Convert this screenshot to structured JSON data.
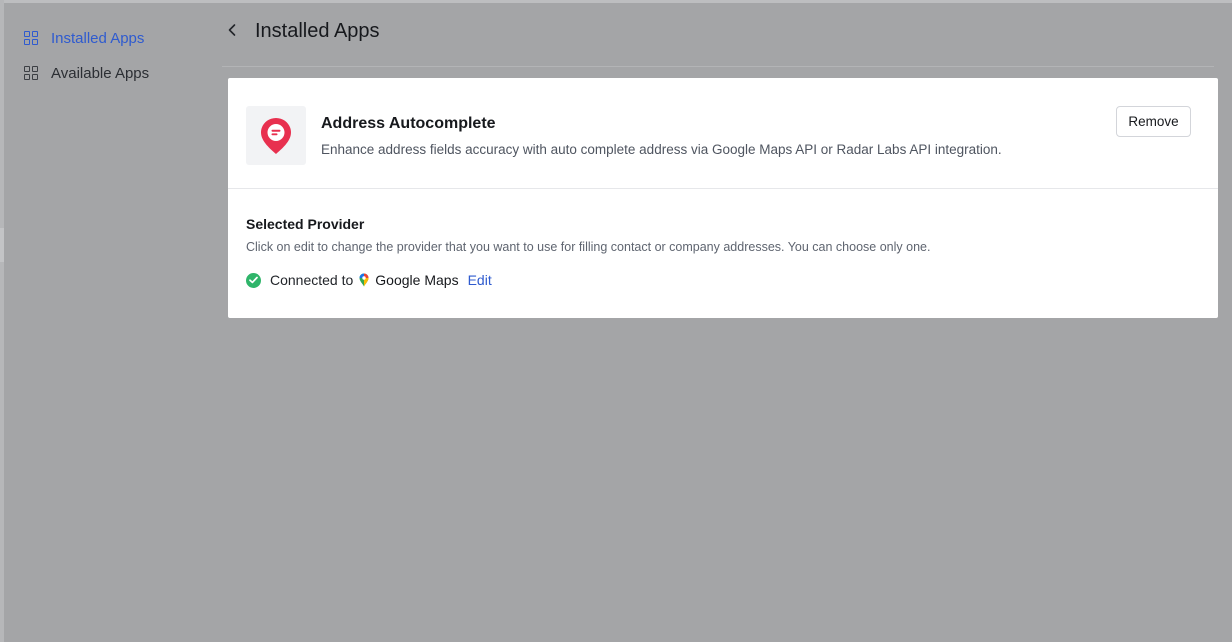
{
  "sidebar": {
    "items": [
      {
        "label": "Installed Apps",
        "icon": "grid-icon",
        "active": true
      },
      {
        "label": "Available Apps",
        "icon": "grid-icon",
        "active": false
      }
    ]
  },
  "header": {
    "back_icon": "chevron-left-icon",
    "title": "Installed Apps"
  },
  "app": {
    "icon": "map-pin-icon",
    "name": "Address Autocomplete",
    "description": "Enhance address fields accuracy with auto complete address via Google Maps API or Radar Labs API integration.",
    "remove_label": "Remove"
  },
  "provider": {
    "title": "Selected Provider",
    "description": "Click on edit to change the provider that you want to use for filling contact or company addresses. You can choose only one.",
    "status_text": "Connected to",
    "provider_name": "Google Maps",
    "edit_label": "Edit",
    "status_icon": "check-circle-icon",
    "provider_icon": "google-maps-pin-icon"
  },
  "colors": {
    "accent": "#2f5bcf",
    "success": "#2fb56a",
    "brand_pin": "#e8304f",
    "overlay": "#a4a5a7"
  }
}
